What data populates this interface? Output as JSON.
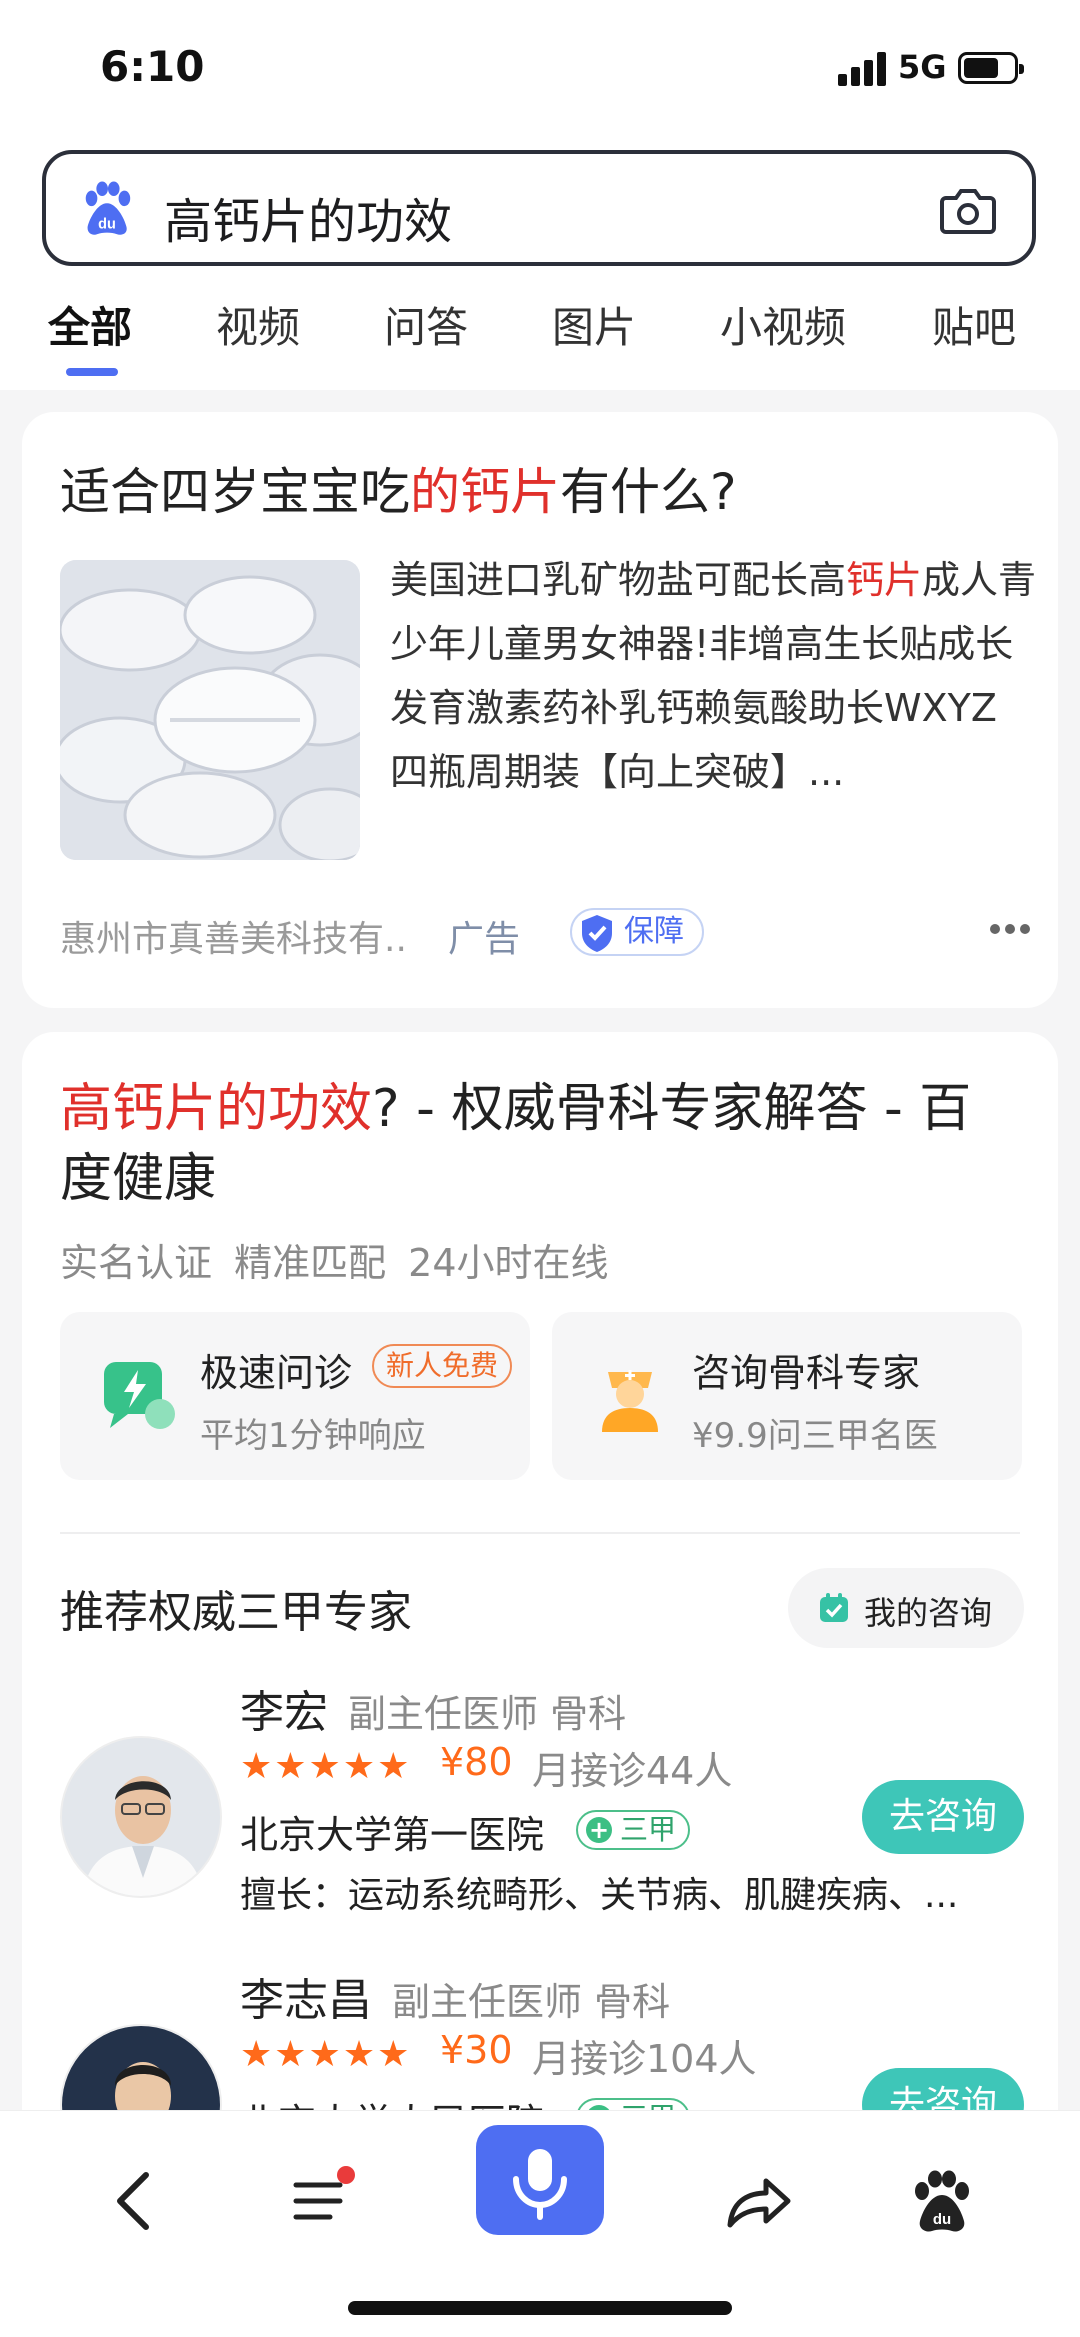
{
  "status_bar": {
    "time": "6:10",
    "network": "5G"
  },
  "search": {
    "query": "高钙片的功效",
    "logo_icon": "baidu-paw-icon",
    "camera_icon": "camera-icon"
  },
  "tabs": [
    {
      "label": "全部",
      "active": true
    },
    {
      "label": "视频"
    },
    {
      "label": "问答"
    },
    {
      "label": "图片"
    },
    {
      "label": "小视频"
    },
    {
      "label": "贴吧"
    }
  ],
  "ad_card": {
    "title_part1": "适合四岁宝宝吃",
    "title_highlight": "的钙片",
    "title_part2": "有什么?",
    "desc_part1": "美国进口乳矿物盐可配长高",
    "desc_highlight": "钙片",
    "desc_part2": "成人青少年儿童男女神器!非增高生长贴成长发育激素药补乳钙赖氨酸助长WXYZ 四瓶周期装【向上突破】...",
    "company": "惠州市真善美科技有..",
    "ad_label": "广告",
    "guarantee_label": "保障"
  },
  "health_card": {
    "title_highlight": "高钙片的功效",
    "title_rest": "? - 权威骨科专家解答 - 百度健康",
    "subtitle": "实名认证 精准匹配 24小时在线",
    "services": [
      {
        "title": "极速问诊",
        "tag": "新人免费",
        "sub": "平均1分钟响应",
        "icon": "lightning-chat-icon"
      },
      {
        "title": "咨询骨科专家",
        "sub": "¥9.9问三甲名医",
        "icon": "doctor-icon"
      }
    ],
    "recommend_title": "推荐权威三甲专家",
    "my_consult_label": "我的咨询",
    "doctors": [
      {
        "name": "李宏",
        "role": "副主任医师 骨科",
        "stars": "★★★★★",
        "rating": 5,
        "price": "¥80",
        "consults": "月接诊44人",
        "hospital": "北京大学第一医院",
        "tier": "三甲",
        "skill": "擅长：运动系统畸形、关节病、肌腱疾病、...",
        "button": "去咨询"
      },
      {
        "name": "李志昌",
        "role": "副主任医师 骨科",
        "stars": "★★★★★",
        "rating": 5,
        "price": "¥30",
        "consults": "月接诊104人",
        "hospital": "北京大学人民医院",
        "tier": "三甲",
        "skill": "",
        "button": "去咨询"
      }
    ]
  },
  "bottom_nav": {
    "items": [
      "back-icon",
      "menu-icon",
      "microphone-icon",
      "share-icon",
      "baidu-home-icon"
    ],
    "accent": "#4e6ef2"
  }
}
